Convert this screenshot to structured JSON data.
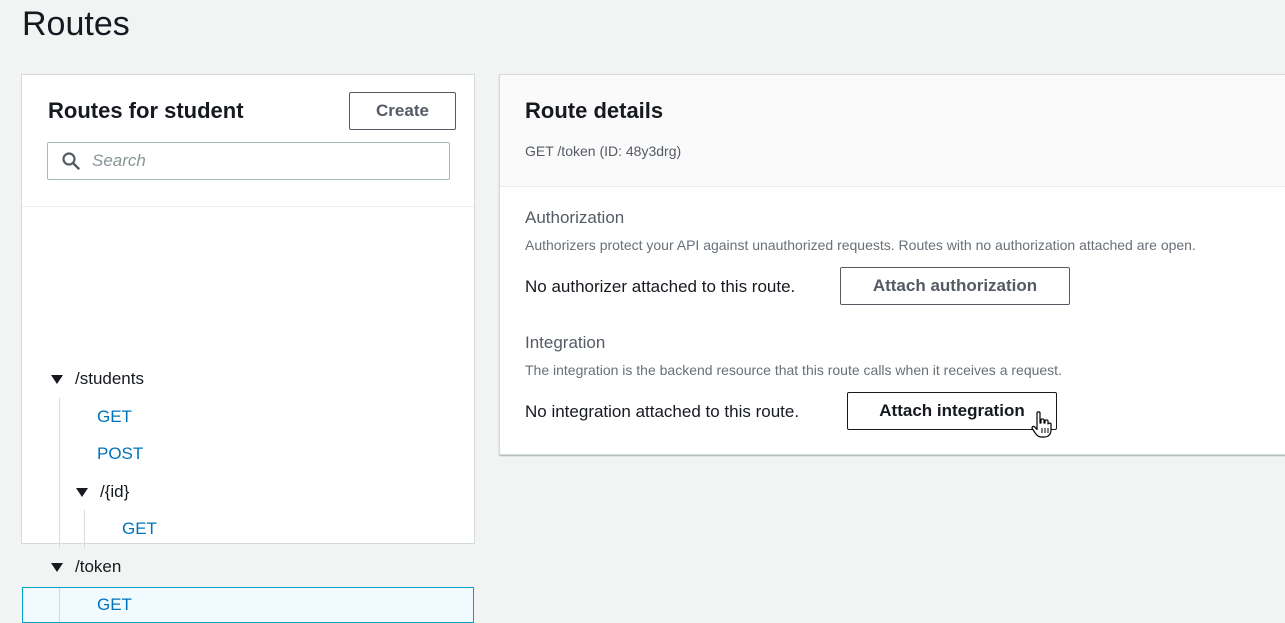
{
  "page": {
    "title": "Routes"
  },
  "left": {
    "title": "Routes for student",
    "create_label": "Create",
    "search_placeholder": "Search",
    "tree": {
      "students": "/students",
      "students_get": "GET",
      "students_post": "POST",
      "id": "/{id}",
      "id_get": "GET",
      "token": "/token",
      "token_get": "GET"
    }
  },
  "right": {
    "title": "Route details",
    "route": "GET /token (ID: 48y3drg)",
    "authorization": {
      "title": "Authorization",
      "description": "Authorizers protect your API against unauthorized requests. Routes with no authorization attached are open.",
      "status": "No authorizer attached to this route.",
      "button": "Attach authorization"
    },
    "integration": {
      "title": "Integration",
      "description": "The integration is the backend resource that this route calls when it receives a request.",
      "status": "No integration attached to this route.",
      "button": "Attach integration"
    }
  },
  "colors": {
    "link": "#0073bb",
    "selected_bg": "#f1faff",
    "selected_border": "#00a1c9"
  },
  "icons": [
    "search-icon",
    "caret-down-icon",
    "hand-cursor-icon"
  ]
}
